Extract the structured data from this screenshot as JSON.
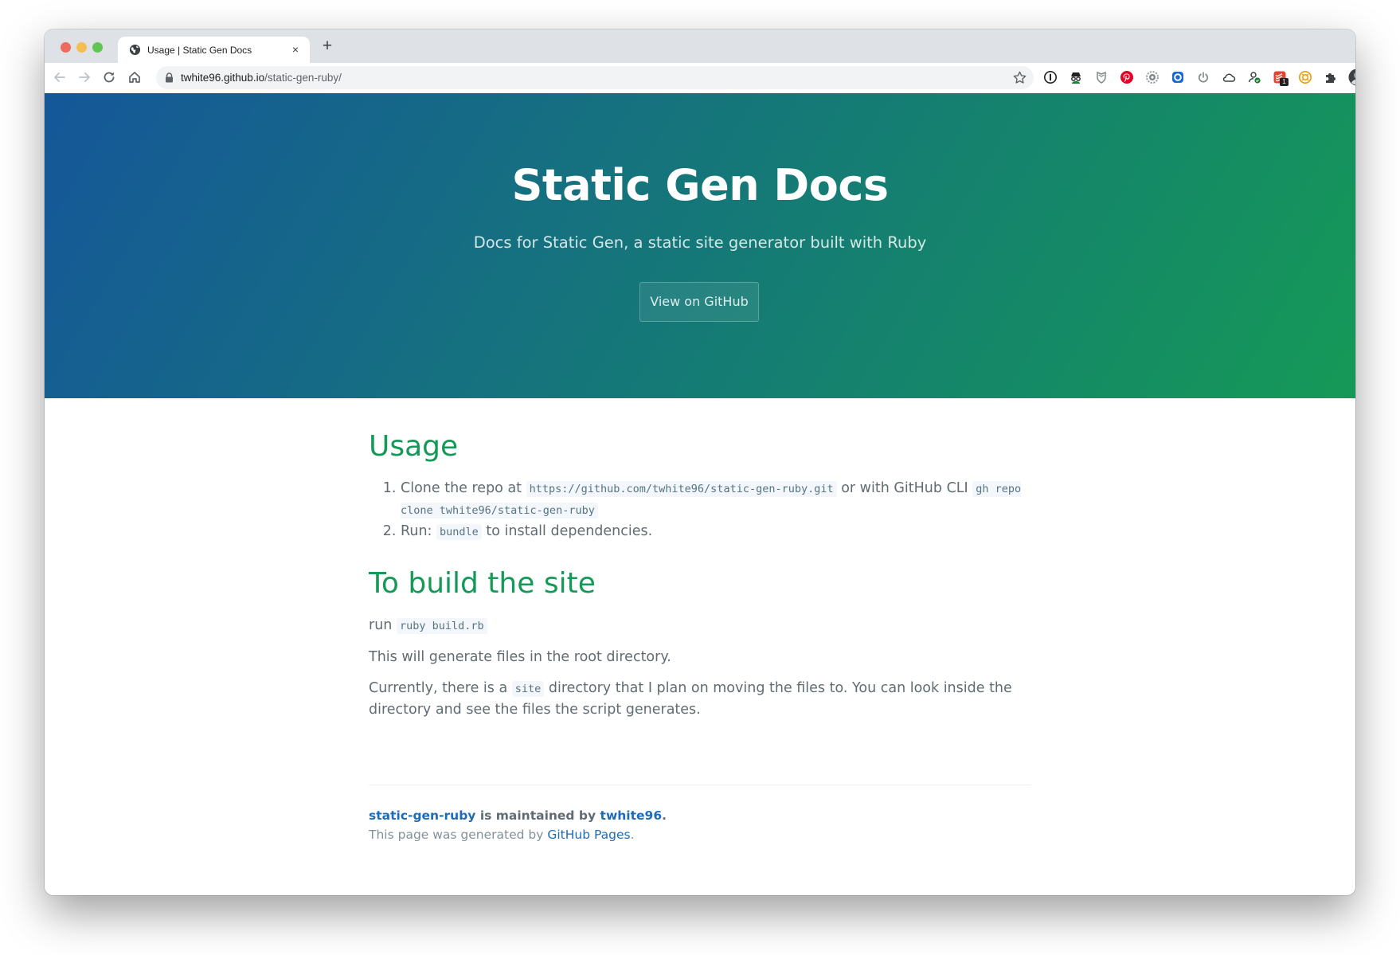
{
  "browser": {
    "tab_title": "Usage | Static Gen Docs",
    "tab_close": "×",
    "new_tab": "+",
    "url_host": "twhite96.github.io",
    "url_path": "/static-gen-ruby/",
    "extension_badge": "1"
  },
  "hero": {
    "title": "Static Gen Docs",
    "tagline": "Docs for Static Gen, a static site generator built with Ruby",
    "button_label": "View on GitHub"
  },
  "usage": {
    "heading": "Usage",
    "step1_text": "Clone the repo at",
    "step1_code_url": "https://github.com/twhite96/static-gen-ruby.git",
    "step1_mid": "or with GitHub CLI",
    "step1_code_cli": "gh repo clone twhite96/static-gen-ruby",
    "step2_text": "Run:",
    "step2_code": "bundle",
    "step2_end": "to install dependencies."
  },
  "build": {
    "heading": "To build the site",
    "run_text": "run",
    "run_code": "ruby build.rb",
    "generate_text": "This will generate files in the root directory.",
    "current_start": "Currently, there is a",
    "current_code": "site",
    "current_end": "directory that I plan on moving the files to. You can look inside the directory and see the files the script generates."
  },
  "footer": {
    "repo_link": "static-gen-ruby",
    "maintained_text": "is maintained by",
    "owner_link": "twhite96",
    "period": ".",
    "generated_text": "This page was generated by",
    "pages_link": "GitHub Pages",
    "end_period": "."
  },
  "colors": {
    "gradient_start": "#155799",
    "gradient_end": "#159957",
    "heading_green": "#159957",
    "link_blue": "#1e6bb8",
    "body_text": "#606c71"
  },
  "icons": {
    "toolbar": [
      "back-arrow-icon",
      "forward-arrow-icon",
      "reload-icon",
      "home-icon",
      "lock-icon",
      "bookmark-star-icon"
    ],
    "extensions": [
      "1password-icon",
      "spy-icon",
      "shield-icon",
      "pinterest-icon",
      "gear-globe-icon",
      "blue-ring-icon",
      "power-icon",
      "cloud-icon",
      "person-sync-icon",
      "todoist-icon",
      "orange-sun-icon",
      "puzzle-icon",
      "profile-avatar-icon",
      "menu-kebab-icon"
    ]
  }
}
